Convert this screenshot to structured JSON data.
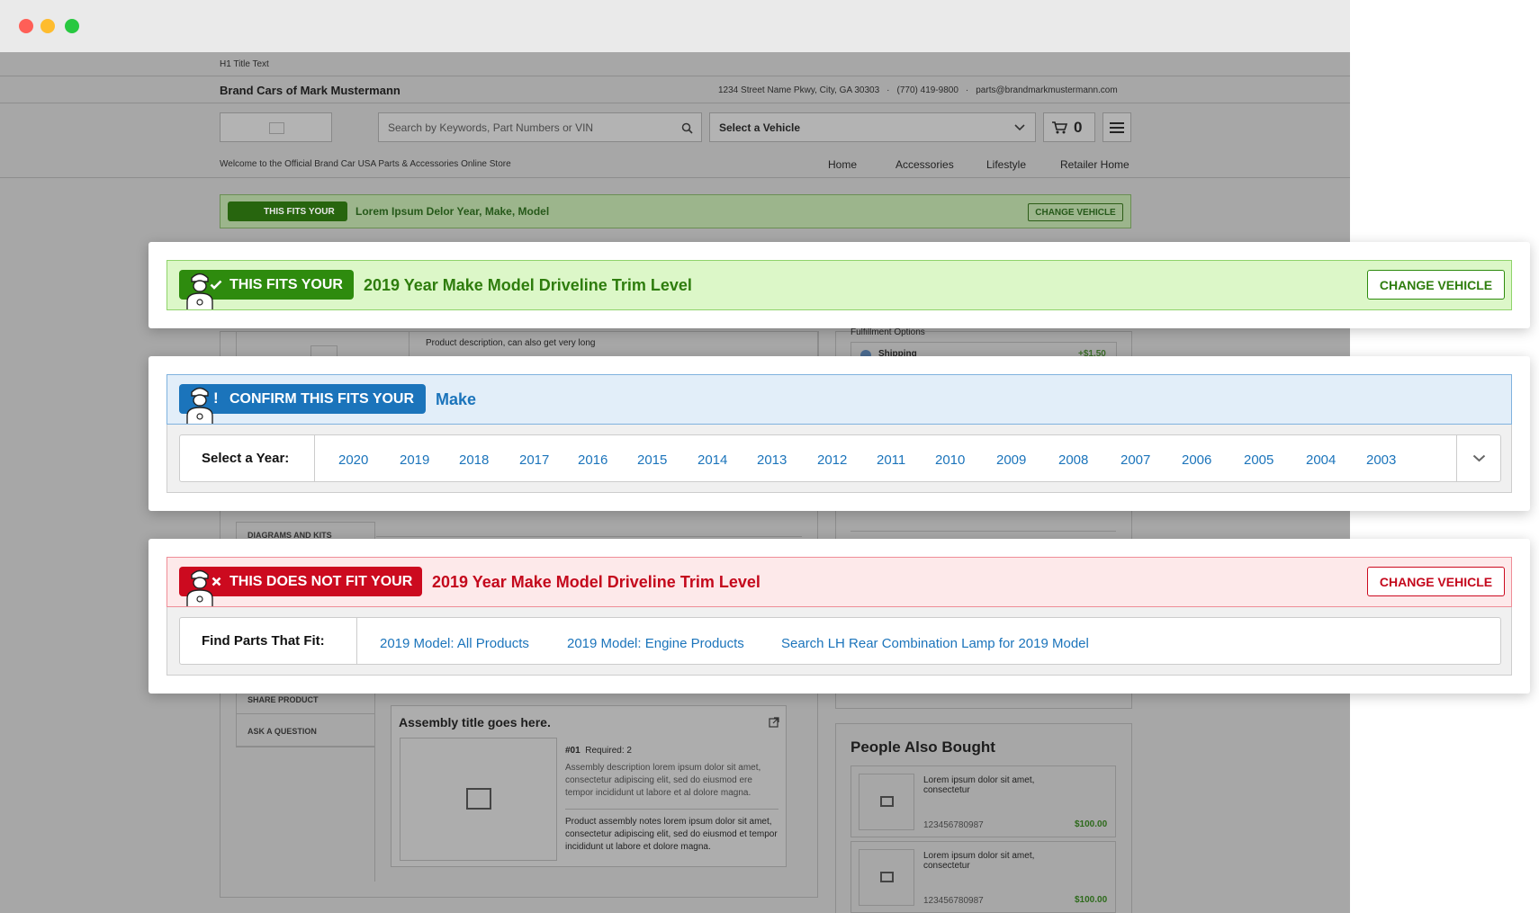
{
  "window": {
    "traffic_lights": [
      "#ff5f57",
      "#febc2e",
      "#28c840"
    ]
  },
  "site": {
    "h1_text": "H1 Title Text",
    "store_name": "Brand Cars of Mark Mustermann",
    "address": "1234 Street Name Pkwy, City, GA 30303",
    "phone": "(770) 419-9800",
    "email": "parts@brandmarkmustermann.com",
    "search_placeholder": "Search by Keywords, Part Numbers or VIN",
    "vehicle_select": "Select a Vehicle",
    "cart_count": "0",
    "welcome": "Welcome to the Official Brand Car USA Parts & Accessories Online Store",
    "nav": [
      "Home",
      "Accessories",
      "Lifestyle",
      "Retailer Home"
    ],
    "mini_fit_badge": "THIS FITS YOUR",
    "mini_fit_vehicle": "Lorem Ipsum Delor Year, Make, Model",
    "mini_change": "CHANGE VEHICLE",
    "product_description": "Product description, can also get very long",
    "fulfillment_label": "Fulfillment Options",
    "shipping_label": "Shipping",
    "shipping_price": "+$1.50",
    "diagrams_tab": "DIAGRAMS AND KITS",
    "share_tab": "SHARE PRODUCT",
    "ask_tab": "ASK A QUESTION",
    "assembly": {
      "title": "Assembly title goes here.",
      "number": "#01",
      "required": "Required: 2",
      "description": "Assembly description lorem ipsum dolor sit amet, consectetur adipiscing elit, sed do eiusmod ere tempor incididunt ut labore et al dolore magna.",
      "notes": "Product assembly notes lorem ipsum dolor sit amet, consectetur adipiscing elit, sed do eiusmod et tempor incididunt ut labore et dolore magna."
    },
    "people_also_bought": {
      "title": "People Also Bought",
      "items": [
        {
          "name": "Lorem ipsum dolor sit amet, consectetur",
          "sku": "123456780987",
          "price": "$100.00"
        },
        {
          "name": "Lorem ipsum dolor sit amet, consectetur",
          "sku": "123456780987",
          "price": "$100.00"
        }
      ]
    }
  },
  "fits": {
    "badge": "THIS FITS YOUR",
    "vehicle": "2019 Year Make Model Driveline Trim Level",
    "change": "CHANGE VEHICLE",
    "colors": {
      "badge": "#2e8b0e",
      "text": "#2e7d0d",
      "bg": "#dcf7c8",
      "border": "#8fd36b"
    }
  },
  "confirm": {
    "badge": "CONFIRM THIS FITS YOUR",
    "make": "Make",
    "select_label": "Select a Year:",
    "years": [
      "2020",
      "2019",
      "2018",
      "2017",
      "2016",
      "2015",
      "2014",
      "2013",
      "2012",
      "2011",
      "2010",
      "2009",
      "2008",
      "2007",
      "2006",
      "2005",
      "2004",
      "2003"
    ],
    "colors": {
      "badge": "#1b74bb",
      "bg": "#e2eef9",
      "border": "#7fb2de"
    }
  },
  "notfit": {
    "badge": "THIS DOES NOT FIT YOUR",
    "vehicle": "2019 Year Make Model Driveline Trim Level",
    "change": "CHANGE VEHICLE",
    "find_label": "Find Parts That Fit:",
    "links": [
      "2019 Model: All Products",
      "2019 Model: Engine Products",
      "Search LH Rear Combination Lamp for 2019 Model"
    ],
    "colors": {
      "badge": "#cc0a1f",
      "text": "#c4081c",
      "bg": "#fde9ea",
      "border": "#ef8d97"
    }
  }
}
